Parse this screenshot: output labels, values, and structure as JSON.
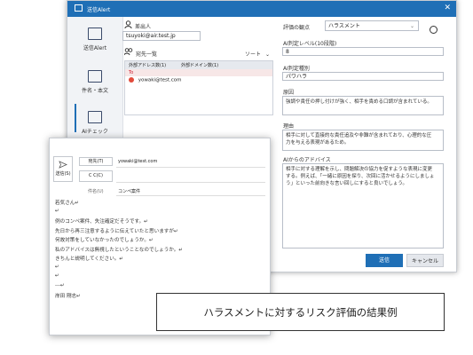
{
  "window": {
    "title": "送信Alert",
    "close": "✕"
  },
  "leftnav": {
    "items": [
      {
        "label": "送信Alert"
      },
      {
        "label": "件名・本文"
      },
      {
        "label": "AIチェック"
      }
    ]
  },
  "sender": {
    "label": "差出人",
    "value": "tsuyoki@air.test.jp"
  },
  "recipients": {
    "label": "宛先一覧",
    "sort_label": "ソート",
    "sort_arrow": "⌄",
    "header_external": "外部アドレス数(1)",
    "header_domain": "外部ドメイン数(1)",
    "to_label": "To",
    "items": [
      {
        "address": "yowaki@test.com"
      }
    ]
  },
  "evaluation": {
    "viewpoint_label": "評価の観点",
    "viewpoint_value": "ハラスメント",
    "level_label": "AI判定レベル(10段階)",
    "level_value": "8",
    "type_label": "AI判定種別",
    "type_value": "パワハラ",
    "cause_label": "原因",
    "cause_value": "強調や責任の押し付けが強く、相手を責める口調が含まれている。",
    "reason_label": "理由",
    "reason_value": "相手に対して直接的な責任追及や非難が含まれており、心理的な圧力を与える表現があるため。",
    "advice_label": "AIからのアドバイス",
    "advice_value": "相手に対する理解を示し、問題解決の協力を促すような表現に変更する。例えば、「一緒に原因を探り、次回に活かせるようにしましょう」といった前向きな言い回しにすると良いでしょう。",
    "send_button": "送信",
    "cancel_button": "キャンセル"
  },
  "compose": {
    "send_label": "送信(S)",
    "to_button": "宛先(T)",
    "to_value": "yowaki@test.com",
    "cc_button": "C C(C)",
    "subject_label": "件名(U)",
    "subject_value": "コンペ案件",
    "body_lines": [
      "若気さん↵",
      "↵",
      "例のコンペ案件、失注確定だそうです。↵",
      "先日から再三注意するように伝えていたと思いますが↵",
      "何故対策をしていなかったのでしょうか。↵",
      "私のアドバイスは無視したということなのでしょうか。↵",
      "きちんと説明してください。↵",
      "↵",
      "↵",
      "---↵",
      "岸田 剛志↵"
    ]
  },
  "caption": "ハラスメントに対するリスク評価の結果例",
  "colors": {
    "accent": "#1f6fb6",
    "danger": "#e24b3b"
  }
}
